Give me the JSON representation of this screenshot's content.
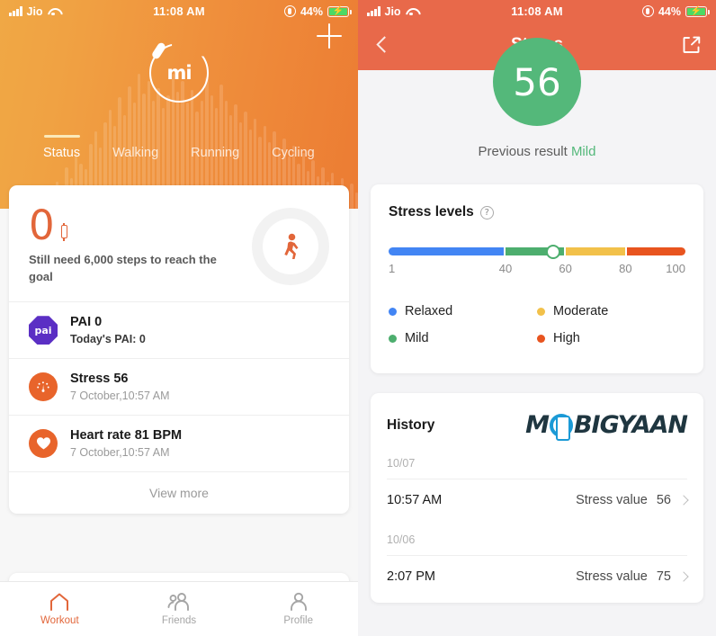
{
  "status_bar": {
    "carrier": "Jio",
    "time": "11:08 AM",
    "battery": "44%",
    "signal_icon": "signal-bars-icon",
    "wifi_icon": "wifi-icon",
    "lock_icon": "rotation-lock-icon",
    "battery_icon": "battery-charging-icon"
  },
  "left_screen": {
    "add_button_icon": "plus-icon",
    "logo_text": "mi",
    "tabs": [
      {
        "label": "Status",
        "active": true
      },
      {
        "label": "Walking",
        "active": false
      },
      {
        "label": "Running",
        "active": false
      },
      {
        "label": "Cycling",
        "active": false
      }
    ],
    "steps": {
      "count": "0",
      "band_icon": "mi-band-icon",
      "subtitle": "Still need 6,000 steps to reach the goal",
      "walk_icon": "walking-person-icon"
    },
    "rows": [
      {
        "icon": "pai-octagon-icon",
        "icon_text": "pai",
        "title": "PAI 0",
        "subtitle": "Today's PAI: 0"
      },
      {
        "icon": "stress-gauge-icon",
        "title": "Stress 56",
        "subtitle": "7 October,10:57 AM"
      },
      {
        "icon": "heart-icon",
        "title": "Heart rate 81 BPM",
        "subtitle": "7 October,10:57 AM"
      }
    ],
    "view_more": "View more",
    "bottom_nav": [
      {
        "label": "Workout",
        "icon": "home-icon",
        "active": true
      },
      {
        "label": "Friends",
        "icon": "friends-icon",
        "active": false
      },
      {
        "label": "Profile",
        "icon": "profile-icon",
        "active": false
      }
    ]
  },
  "right_screen": {
    "header": {
      "title": "Stress",
      "back_icon": "chevron-left-icon",
      "share_icon": "share-external-icon"
    },
    "score": {
      "value": "56",
      "color": "#54b87a",
      "previous_label": "Previous result",
      "previous_value": "Mild"
    },
    "stress_levels": {
      "title": "Stress levels",
      "help_icon": "question-mark-icon",
      "current_value": 56,
      "legend": [
        {
          "label": "Relaxed",
          "color": "#4285f4"
        },
        {
          "label": "Moderate",
          "color": "#f2c14a"
        },
        {
          "label": "Mild",
          "color": "#4dae6e"
        },
        {
          "label": "High",
          "color": "#e8541f"
        }
      ]
    },
    "history": {
      "title": "History",
      "watermark": {
        "pre": "M",
        "o": "O",
        "post": "BIGYAAN"
      },
      "groups": [
        {
          "date": "10/07",
          "entries": [
            {
              "time": "10:57  AM",
              "label": "Stress value",
              "value": "56",
              "chevron": "chevron-right-icon"
            }
          ]
        },
        {
          "date": "10/06",
          "entries": [
            {
              "time": "2:07  PM",
              "label": "Stress value",
              "value": "75",
              "chevron": "chevron-right-icon"
            }
          ]
        }
      ]
    }
  },
  "chart_data": {
    "type": "bar",
    "title": "Stress levels",
    "xlabel": "",
    "ylabel": "",
    "categories": [
      "Relaxed",
      "Mild",
      "Moderate",
      "High"
    ],
    "values": [
      40,
      20,
      20,
      20
    ],
    "segments": [
      {
        "name": "Relaxed",
        "from": 1,
        "to": 40,
        "color": "#4285f4"
      },
      {
        "name": "Mild",
        "from": 40,
        "to": 60,
        "color": "#4dae6e"
      },
      {
        "name": "Moderate",
        "from": 60,
        "to": 80,
        "color": "#f2c14a"
      },
      {
        "name": "High",
        "from": 80,
        "to": 100,
        "color": "#e8541f"
      }
    ],
    "tick_labels": [
      "1",
      "40",
      "60",
      "80",
      "100"
    ],
    "tick_positions": [
      1,
      40,
      60,
      80,
      100
    ],
    "xlim": [
      1,
      100
    ],
    "marker_value": 56,
    "legend_position": "below",
    "grid": false,
    "history_series": {
      "name": "Stress value",
      "x": [
        "10/06 2:07 PM",
        "10/07 10:57 AM"
      ],
      "y": [
        75,
        56
      ]
    }
  }
}
